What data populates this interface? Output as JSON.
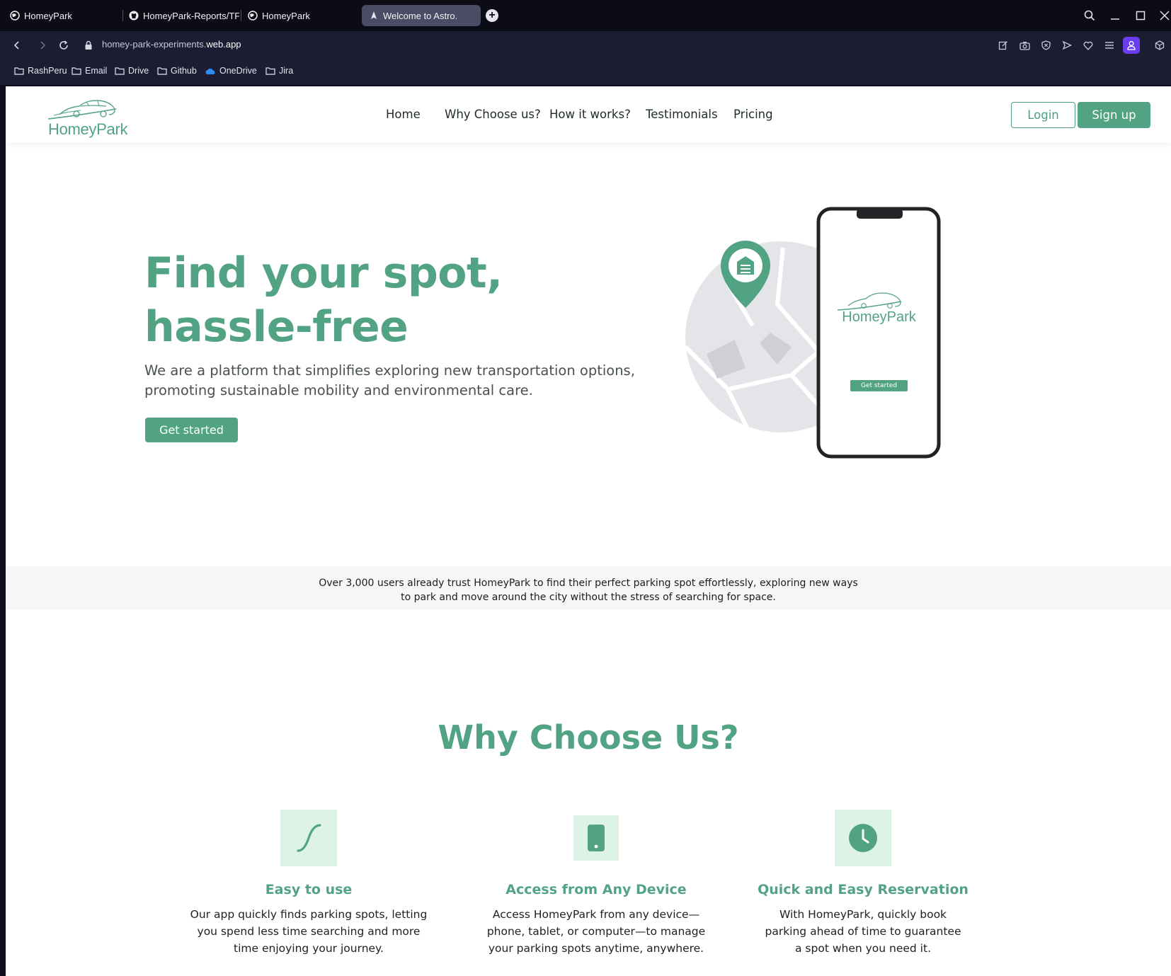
{
  "browser": {
    "tabs": [
      {
        "label": "HomeyPark",
        "icon": "globe-icon"
      },
      {
        "label": "HomeyPark-Reports/TF1/...",
        "icon": "github-icon"
      },
      {
        "label": "HomeyPark",
        "icon": "globe-icon"
      },
      {
        "label": "Welcome to Astro.",
        "icon": "astro-icon",
        "active": true
      }
    ],
    "url_prefix": "homey-park-experiments.",
    "url_domain": "web.app",
    "bookmarks": [
      "RashPeru",
      "Email",
      "Drive",
      "Github",
      "OneDrive",
      "Jira"
    ]
  },
  "site": {
    "logo_text": "HomeyPark",
    "nav": [
      "Home",
      "Why Choose us?",
      "How it works?",
      "Testimonials",
      "Pricing"
    ],
    "login_label": "Login",
    "signup_label": "Sign up"
  },
  "hero": {
    "title_line1": "Find your spot,",
    "title_line2": "hassle-free",
    "subtitle": "We are a platform that simplifies exploring new transportation options, promoting sustainable mobility and environmental care.",
    "cta_label": "Get started",
    "phone_logo_text": "HomeyPark",
    "phone_cta_label": "Get started"
  },
  "trust": {
    "text": "Over 3,000 users already trust HomeyPark to find their perfect parking spot effortlessly, exploring new ways to park and move around the city without the stress of searching for space."
  },
  "why": {
    "title": "Why Choose Us?",
    "features": [
      {
        "title": "Easy to use",
        "desc": "Our app quickly finds parking spots, letting you spend less time searching and more time enjoying your journey.",
        "icon": "curve-icon"
      },
      {
        "title": "Access from Any Device",
        "desc": "Access HomeyPark from any device—phone, tablet, or computer—to manage your parking spots anytime, anywhere.",
        "icon": "phone-icon"
      },
      {
        "title": "Quick and Easy Reservation",
        "desc": "With HomeyPark, quickly book parking ahead of time to guarantee a spot when you need it.",
        "icon": "clock-icon"
      }
    ]
  },
  "colors": {
    "brand_green": "#52a384",
    "icon_bg": "#dcf3e6",
    "browser_dark": "#0b0c16"
  }
}
